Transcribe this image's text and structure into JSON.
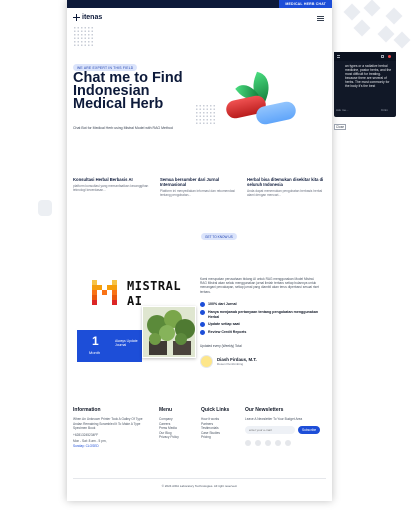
{
  "topbar": {
    "cta": "MEDICAL HERB CHAT"
  },
  "nav": {
    "logo_text": "itenas"
  },
  "hero": {
    "badge": "WE ARE EXPERT IN THIS FIELD",
    "title": "Chat me to Find Indonesian Medical Herb",
    "subtitle": "Chat Bot for Medical Herb using Mistral Model with RAG Method"
  },
  "features": [
    {
      "title": "Konsultasi Herbal Berbasis AI",
      "desc": "platform konsultasi yang memanfaatkan kecanggihan teknologi kecerdasan..."
    },
    {
      "title": "Semua bersumber dari Jurnal Internasional",
      "desc": "Platform ini menyediakan informasi dan rekomendasi tentang pengobatan..."
    },
    {
      "title": "Herbal bisa ditemukan disekitar kita di seluruh Indonesia",
      "desc": "Anda dapat menemukan pengobatan berbasis herbal alami dengan mencari..."
    }
  ],
  "about": {
    "chip": "GET TO KNOW US",
    "brand_line1": "MISTRAL",
    "brand_line2": "AI",
    "month_number": "1",
    "month_label": "Month",
    "month_desc": "Always Update Journal",
    "text": "Kami merupakan perusahaan bidang AI untuk RAG menggunakan Model Mistral. RAG Mistral akan selalu menggunakan jurnal ilmiah terbaru setiap bulannya untuk menangani percakapan, setiap jurnal yang diambil akan terus diperbarui sesuai riset terbaru.",
    "checklist": [
      "100% dari Jurnal",
      "Hanya menjawab pertanyaan tentang pengobatan menggunakan Herbal",
      "Update setiap saat",
      "Review Credit Reports"
    ],
    "link_text": "Updated every (Weekly) Total",
    "author_name": "Diash Firdaus, M.T.",
    "author_role": "Dosen Pembimbing"
  },
  "footer": {
    "info_title": "Information",
    "info_text": "When An Unknown Printer Took A Galley Of Type Andan Remaining Scrambled It To Make A Type Specimen Book",
    "phone": "+62813245234FF",
    "hours1": "Mon - Sat: 8 am - 5 pm,",
    "hours2": "Sunday: CLOSED",
    "menu_title": "Menu",
    "menu_items": [
      "Company",
      "Careers",
      "Press Media",
      "Our Blog",
      "Privacy Policy"
    ],
    "links_title": "Quick Links",
    "links_items": [
      "How it works",
      "Partners",
      "Testimonials",
      "Case Studies",
      "Pricing"
    ],
    "news_title": "Our Newsletters",
    "news_desc": "Leave A Newsletter To Your Budget Area",
    "news_placeholder": "enter your e-mail",
    "news_button": "Subscribe",
    "copyright": "© 2024 AIDA Laboratory Technologies. All right reserved."
  },
  "chat": {
    "message": "an types or a radiative herbal medicine, pastor herbs, and the most difficult for treating. because there are several of herbs. The most commonly for the body it's the best",
    "input_placeholder": "Ask me...",
    "send_label": "Kirim"
  },
  "close_label": "Close",
  "colors": {
    "navy": "#0d1a3a",
    "accent": "#1d4ed8",
    "orange": "#f97316"
  }
}
